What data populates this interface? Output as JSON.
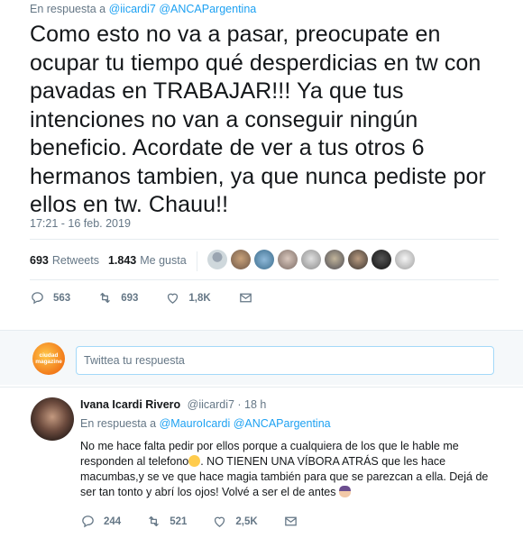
{
  "tweet": {
    "reply_prefix": "En respuesta a",
    "reply_handles": "@iicardi7 @ANCAPargentina",
    "text": "Como esto no va a pasar, preocupate en ocupar tu tiempo qué desperdicias en tw con pavadas en TRABAJAR!!! Ya que tus intenciones no van a conseguir ningún beneficio. Acordate de ver a tus otros 6 hermanos tambien, ya que nunca pediste por ellos en tw. Chauu!!",
    "timestamp": "17:21 - 16 feb. 2019",
    "retweets_count": "693",
    "retweets_label": "Retweets",
    "likes_count": "1.843",
    "likes_label": "Me gusta",
    "liker_avatar_icons": [
      "avatar-1",
      "avatar-2",
      "avatar-3",
      "avatar-4",
      "avatar-5",
      "avatar-6",
      "avatar-7",
      "avatar-8",
      "avatar-9"
    ],
    "actions": {
      "replies": "563",
      "retweets": "693",
      "likes": "1,8K"
    }
  },
  "composer": {
    "avatar_text": "ciudad magazine",
    "placeholder": "Twittea tu respuesta"
  },
  "reply": {
    "name": "Ivana Icardi Rivero",
    "handle_time": "@iicardi7 · 18 h",
    "reply_prefix": "En respuesta a",
    "reply_handles": "@MauroIcardi @ANCAPargentina",
    "text_part1": "No me hace falta pedir por ellos porque a cualquiera de los que le hable me responden al telefono",
    "text_part2": ". NO TIENEN UNA VÍBORA ATRÁS que les hace macumbas,y se ve que hace magia también para que se parezcan a ella. Dejá de ser tan tonto y abrí los ojos! Volvé a ser el de antes",
    "actions": {
      "replies": "244",
      "retweets": "521",
      "likes": "2,5K"
    }
  },
  "colors": {
    "link": "#1da1f2",
    "secondary_text": "#657786",
    "primary_text": "#14171a",
    "divider": "#e6ecf0",
    "band": "#f5f8fa"
  }
}
